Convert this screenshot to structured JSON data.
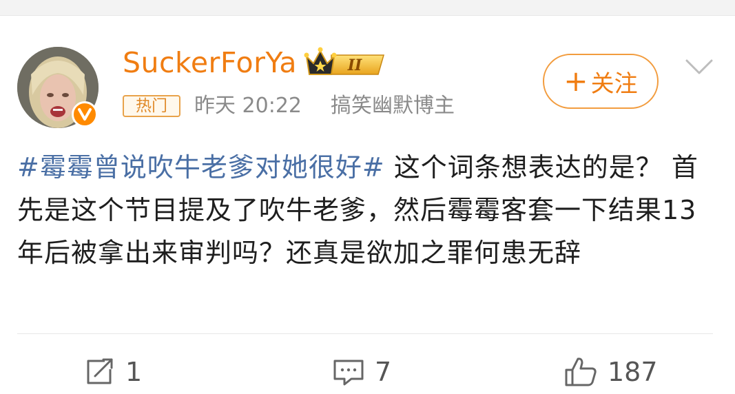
{
  "post": {
    "author": {
      "name": "SuckerForYa",
      "vip_level": "II",
      "verified": true
    },
    "meta": {
      "tag": "热门",
      "time": "昨天 20:22",
      "description": "搞笑幽默博主"
    },
    "follow_label": "关注",
    "follow_prefix": "+",
    "hashtag": "#霉霉曾说吹牛老爹对她很好#",
    "text": " 这个词条想表达的是？ 首先是这个节目提及了吹牛老爹，然后霉霉客套一下结果13年后被拿出来审判吗？还真是欲加之罪何患无辞"
  },
  "actions": {
    "share_count": "1",
    "comment_count": "7",
    "like_count": "187"
  },
  "icons": {
    "share": "share-icon",
    "comment": "comment-icon",
    "like": "thumbs-up-icon",
    "more": "chevron-down-icon",
    "verified": "verified-v-icon",
    "vip": "crown-icon"
  },
  "colors": {
    "brand_orange": "#f07d12",
    "hashtag_blue": "#4a6fa5",
    "meta_gray": "#8a8a8a"
  }
}
